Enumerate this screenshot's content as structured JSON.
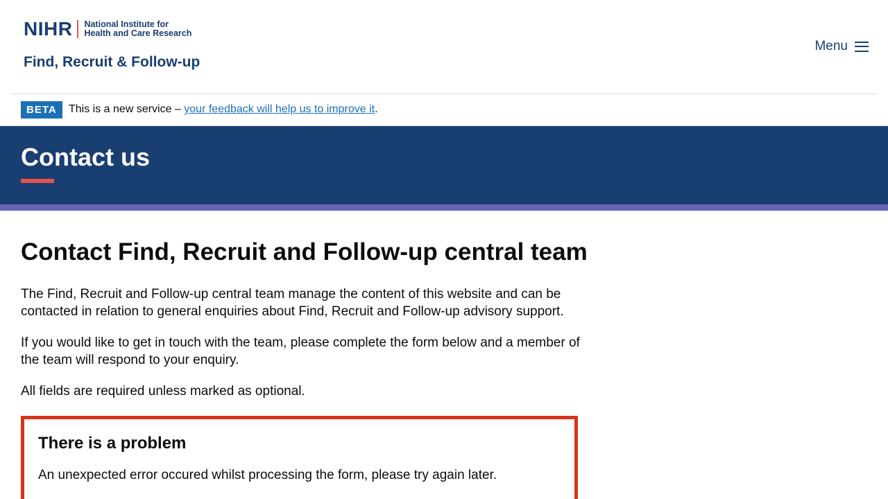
{
  "header": {
    "logo_mark": "NIHR",
    "logo_line1": "National Institute for",
    "logo_line2": "Health and Care Research",
    "service_name": "Find, Recruit & Follow-up",
    "menu_label": "Menu"
  },
  "beta": {
    "tag": "BETA",
    "text_before": "This is a new service – ",
    "link_text": "your feedback will help us to improve it",
    "text_after": "."
  },
  "hero": {
    "title": "Contact us"
  },
  "main": {
    "heading": "Contact Find, Recruit and Follow-up central team",
    "paragraphs": [
      "The Find, Recruit and Follow-up central team manage the content of this website and can be contacted in relation to general enquiries about Find, Recruit and Follow-up advisory support.",
      "If you would like to get in touch with the team, please complete the form below and a member of the team will respond to your enquiry.",
      "All fields are required unless marked as optional."
    ]
  },
  "error": {
    "title": "There is a problem",
    "message": "An unexpected error occured whilst processing the form, please try again later."
  },
  "colors": {
    "brand_navy": "#193e72",
    "accent_coral": "#e5544b",
    "stripe_purple": "#6a66b3",
    "link_blue": "#1d70b8",
    "error_red": "#d4351c"
  }
}
